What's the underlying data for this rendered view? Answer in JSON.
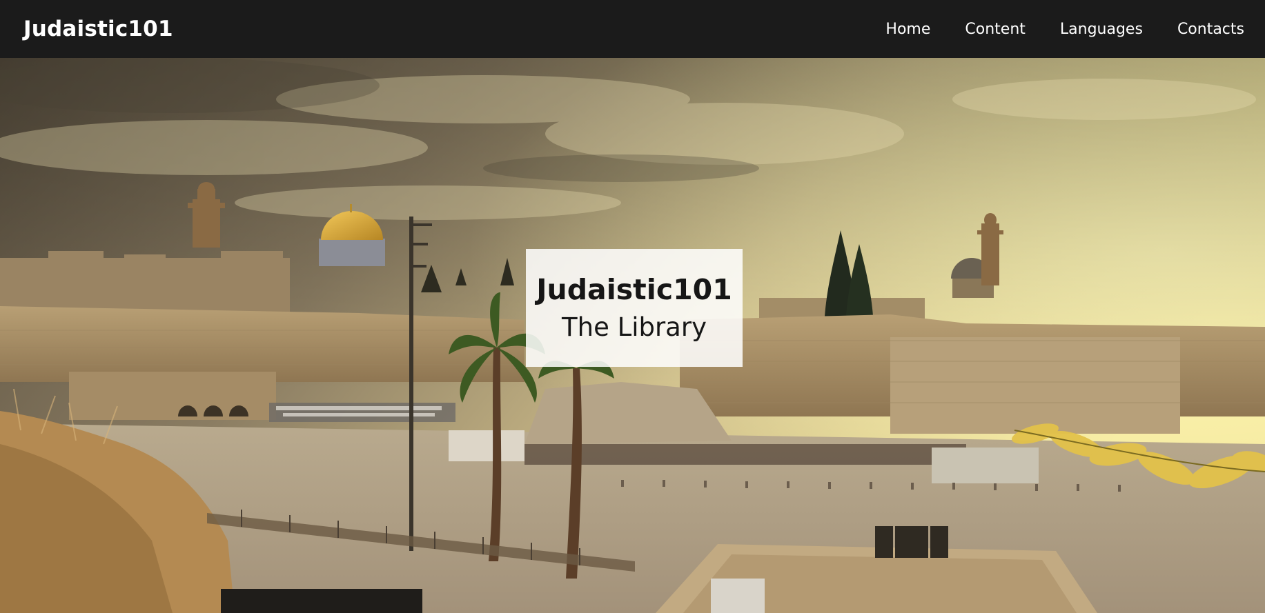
{
  "navbar": {
    "brand": "Judaistic101",
    "links": [
      {
        "label": "Home"
      },
      {
        "label": "Content"
      },
      {
        "label": "Languages"
      },
      {
        "label": "Contacts"
      }
    ]
  },
  "hero": {
    "title": "Judaistic101",
    "subtitle": "The Library",
    "image": "jerusalem-western-wall-panorama"
  },
  "colors": {
    "navbar_bg": "#1b1b1b",
    "nav_text": "#ffffff",
    "overlay_bg": "rgba(255,255,255,0.86)",
    "overlay_text": "#161616"
  }
}
